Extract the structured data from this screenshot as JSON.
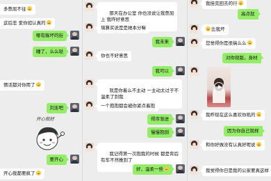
{
  "panel1": {
    "messages": [
      {
        "side": "left",
        "text": "多憋屈不往"
      },
      {
        "side": "left",
        "text": "这后悲 爱你如认真的"
      },
      {
        "side": "right",
        "text": "哪有躲坏的街"
      },
      {
        "side": "right",
        "text": "睡了，么么哒"
      },
      {
        "side": "left",
        "text": "情话都对你用了"
      },
      {
        "side": "right",
        "text": "刘澎吧"
      },
      {
        "side": "right",
        "text": "要开心"
      },
      {
        "side": "left",
        "text": "开心我都要疯了"
      }
    ],
    "sticker_text": "开心就好"
  },
  "panel2": {
    "messages": [
      {
        "side": "left",
        "text": "那天在办公室 你也没说让我憋屈\n上 我昨好意思"
      },
      {
        "side": "left",
        "text": "填算买说是是她本分嘛"
      },
      {
        "side": "right",
        "text": "我未来"
      },
      {
        "side": "left",
        "text": "你也不好意思"
      },
      {
        "side": "right",
        "text": "我可以"
      },
      {
        "side": "left",
        "text": "就是你着么不主动 一主动太过于不\n温柔了到我"
      },
      {
        "side": "left",
        "text": "一个抱抱都会被你紧点着抱"
      },
      {
        "side": "right",
        "text": "得序渐进"
      },
      {
        "side": "right",
        "text": "慢慢抱倒"
      },
      {
        "side": "left",
        "text": "我记得第一次抱我的时候 都是背后\n有车不然推到了"
      },
      {
        "side": "right",
        "text": "好，温柔一些"
      }
    ]
  },
  "panel3": {
    "messages": [
      {
        "side": "left",
        "text": "我挂完回去的行"
      },
      {
        "side": "right",
        "text": "高点就"
      },
      {
        "side": "left",
        "text": "比我坏"
      },
      {
        "side": "left",
        "text": "您觉得你是很搞么么"
      },
      {
        "side": "right",
        "text": "对你现版，身材"
      },
      {
        "side": "left",
        "text": "我昨现在这么喜欢你吼的"
      },
      {
        "side": "right",
        "text": "因为你自己就样"
      },
      {
        "side": "left",
        "text": "和你好做没有认真好呢说"
      },
      {
        "side": "left",
        "text": "我觉得你日是我的公家要真这样"
      }
    ]
  },
  "colors": {
    "background": "#ededed",
    "bubble_green": "#95ec69",
    "bubble_white": "#ffffff"
  },
  "icons": [
    "girl-avatar",
    "boy-avatar",
    "smiley-emoji",
    "video-play-icon"
  ]
}
